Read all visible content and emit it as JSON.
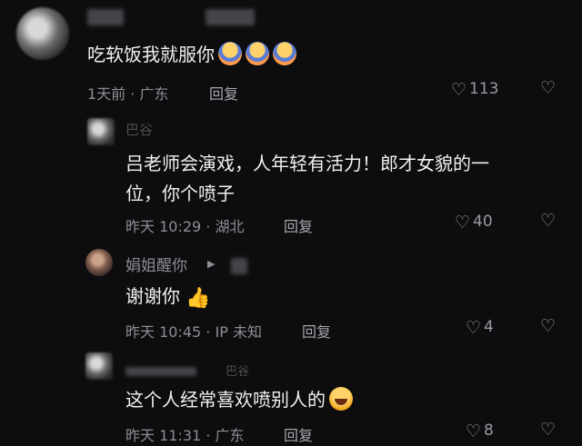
{
  "comments": [
    {
      "content": "吃软饭我就服你",
      "emojis": [
        "shrug-emoji",
        "shrug-emoji",
        "shrug-emoji"
      ],
      "time": "1天前",
      "location": "广东",
      "reply_label": "回复",
      "likes": "113"
    },
    {
      "username": "巴谷",
      "content_line1": "吕老师会演戏，人年轻有活力！郎才女貌的一",
      "content_line2": "位，你个喷子",
      "time": "昨天 10:29",
      "location": "湖北",
      "reply_label": "回复",
      "likes": "40"
    },
    {
      "username": "娟姐醒你",
      "content": "谢谢你",
      "emoji": "thumbs-up-emoji",
      "time": "昨天 10:45",
      "location": "IP 未知",
      "reply_label": "回复",
      "likes": "4"
    },
    {
      "username": "巴谷",
      "content": "这个人经常喜欢喷别人的",
      "emoji": "grinning-emoji",
      "time": "昨天 11:31",
      "location": "广东",
      "reply_label": "回复",
      "likes": "8"
    }
  ],
  "separator": "·",
  "icons": {
    "heart": "heart-outline-icon",
    "dislike": "broken-heart-icon"
  }
}
